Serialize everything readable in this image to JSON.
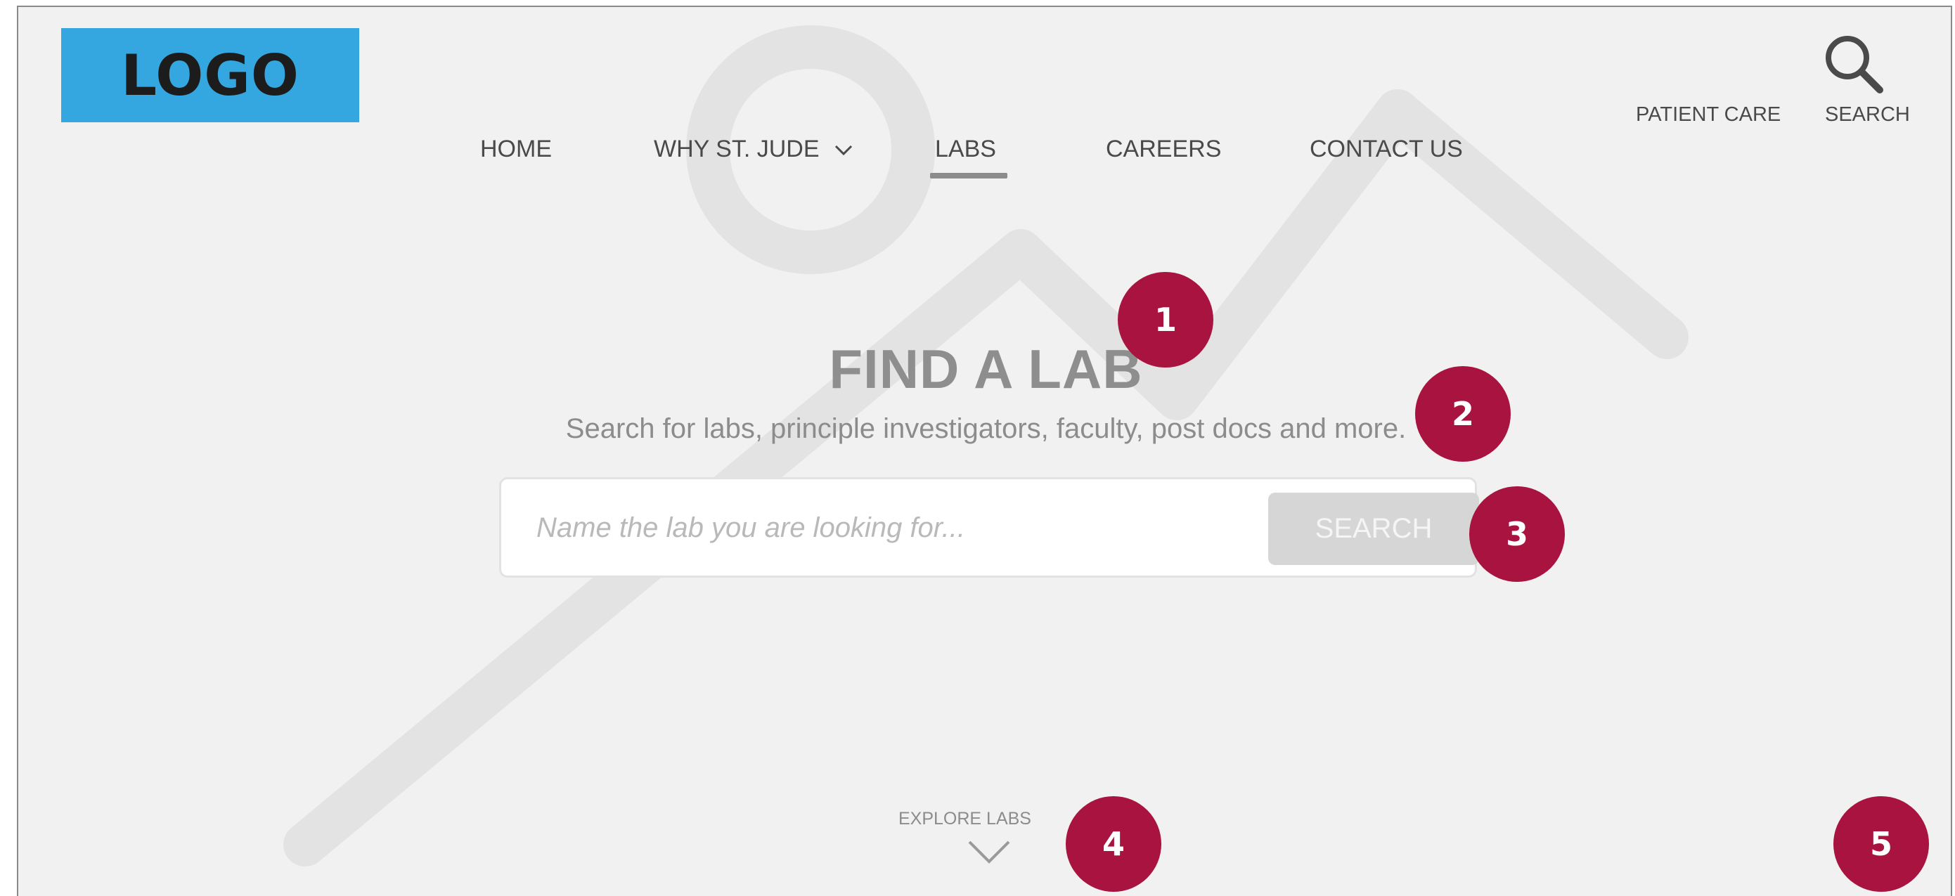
{
  "logo": {
    "text": "LOGO"
  },
  "nav": {
    "items": [
      {
        "label": "HOME"
      },
      {
        "label": "WHY ST. JUDE",
        "has_dropdown": true
      },
      {
        "label": "LABS",
        "active": true
      },
      {
        "label": "CAREERS"
      },
      {
        "label": "CONTACT US"
      }
    ]
  },
  "utility": {
    "patient_care": "PATIENT CARE",
    "search_label": "SEARCH",
    "search_icon": "search-icon"
  },
  "hero": {
    "title": "FIND A LAB",
    "subtitle": "Search for labs, principle investigators, faculty, post docs and more.",
    "search": {
      "placeholder": "Name the lab you are looking for...",
      "value": "",
      "button_label": "SEARCH"
    },
    "explore": {
      "label": "EXPLORE LABS",
      "icon": "chevron-down-icon"
    }
  },
  "annotations": [
    "1",
    "2",
    "3",
    "4",
    "5"
  ],
  "colors": {
    "logo_bg": "#34a7e0",
    "marker": "#a8133f",
    "background": "#f1f1f1",
    "nav_active_underline": "#8c8c8c"
  }
}
